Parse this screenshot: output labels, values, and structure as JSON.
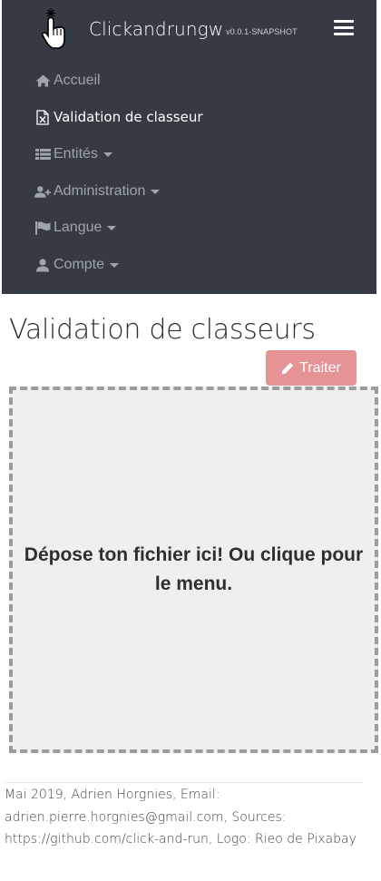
{
  "navbar": {
    "brand": "Clickandrungw",
    "version": "v0.0.1-SNAPSHOT",
    "menu_icon": "hamburger-menu-icon",
    "items": [
      {
        "label": "Accueil",
        "icon": "home-icon",
        "active": false,
        "dropdown": false
      },
      {
        "label": "Validation de classeur",
        "icon": "excel-file-icon",
        "active": true,
        "dropdown": false
      },
      {
        "label": "Entités",
        "icon": "list-icon",
        "active": false,
        "dropdown": true
      },
      {
        "label": "Administration",
        "icon": "user-plus-icon",
        "active": false,
        "dropdown": true
      },
      {
        "label": "Langue",
        "icon": "flag-icon",
        "active": false,
        "dropdown": true
      },
      {
        "label": "Compte",
        "icon": "user-icon",
        "active": false,
        "dropdown": true
      }
    ]
  },
  "main": {
    "title": "Validation de classeurs",
    "process_button": "Traiter",
    "process_icon": "pencil-icon",
    "dropzone_message": "Dépose ton fichier ici! Ou clique pour le menu."
  },
  "footer": {
    "text": "Mai 2019, Adrien Horgnies, Email: adrien.pierre.horgnies@gmail.com, Sources: https://github.com/click-and-run, Logo: Rieo de Pixabay"
  },
  "colors": {
    "navbar_bg": "#353a43",
    "nav_text": "#9da5b0",
    "button_bg": "#e59395",
    "dropzone_bg": "#efefef"
  }
}
